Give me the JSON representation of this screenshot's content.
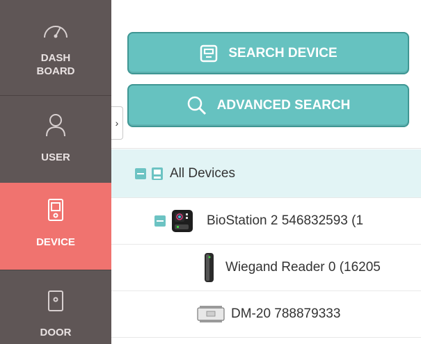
{
  "sidebar": {
    "items": [
      {
        "label_line1": "DASH",
        "label_line2": "BOARD",
        "icon": "gauge-icon"
      },
      {
        "label": "USER",
        "icon": "user-icon"
      },
      {
        "label": "DEVICE",
        "icon": "device-icon",
        "active": true
      },
      {
        "label": "DOOR",
        "icon": "door-icon"
      }
    ],
    "collapse_toggle": "›"
  },
  "buttons": {
    "search_device": "SEARCH DEVICE",
    "advanced_search": "ADVANCED SEARCH"
  },
  "tree": {
    "root": "All Devices",
    "items": [
      {
        "label": "BioStation 2 546832593 (1",
        "icon": "biostation-icon"
      },
      {
        "label": "Wiegand Reader 0 (16205",
        "icon": "wiegand-reader-icon"
      },
      {
        "label": "DM-20 788879333",
        "icon": "dm20-module-icon"
      }
    ]
  },
  "colors": {
    "sidebar": "#5f5656",
    "active": "#f0736f",
    "button": "#66c2c0",
    "button_border": "#3f9693",
    "selected_row": "#e2f4f5"
  }
}
